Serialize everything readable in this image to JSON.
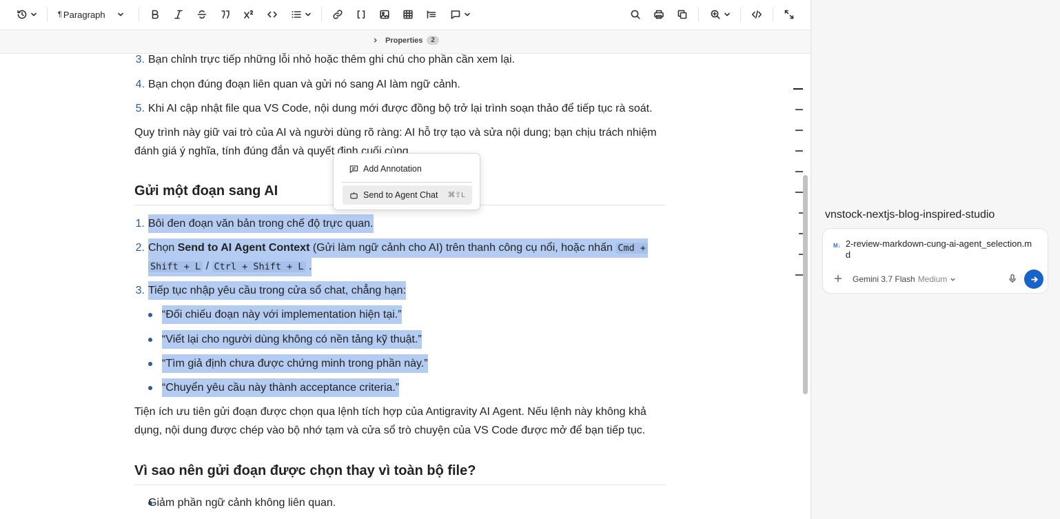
{
  "toolbar": {
    "paragraph_style": "Paragraph",
    "paragraph_mark": "¶"
  },
  "properties": {
    "label": "Properties",
    "count": "2"
  },
  "doc": {
    "item3": {
      "num": "3.",
      "text": "Bạn chỉnh trực tiếp những lỗi nhỏ hoặc thêm ghi chú cho phần cần xem lại."
    },
    "item4": {
      "num": "4.",
      "text": "Bạn chọn đúng đoạn liên quan và gửi nó sang AI làm ngữ cảnh."
    },
    "item5": {
      "num": "5.",
      "text": "Khi AI cập nhật file qua VS Code, nội dung mới được đồng bộ trở lại trình soạn thảo để tiếp tục rà soát."
    },
    "para1_line1": "Quy trình này giữ vai trò của AI và người dùng rõ ràng: AI hỗ trợ tạo và sửa nội dung; bạn chịu trách nhiệm",
    "para1_line2": "đánh giá ý nghĩa, tính đúng đắn và quyết định cuối cùng.",
    "heading1": "Gửi một đoạn sang AI",
    "step1": {
      "num": "1.",
      "text": "Bôi đen đoạn văn bản trong chế độ trực quan."
    },
    "step2": {
      "num": "2.",
      "pre": "Chọn ",
      "bold": "Send to AI Agent Context",
      "post": " (Gửi làm ngữ cảnh cho AI) trên thanh công cụ nổi, hoặc nhấn ",
      "code1a": "Cmd +",
      "code1b": "Shift + L",
      "slash": "/",
      "code2": "Ctrl + Shift + L",
      "end": "."
    },
    "step3": {
      "num": "3.",
      "text": "Tiếp tục nhập yêu cầu trong cửa sổ chat, chẳng hạn:"
    },
    "bullets": [
      "“Đối chiếu đoạn này với implementation hiện tại.”",
      "“Viết lại cho người dùng không có nền tảng kỹ thuật.”",
      "“Tìm giả định chưa được chứng minh trong phần này.”",
      "“Chuyển yêu cầu này thành acceptance criteria.”"
    ],
    "para2_line1": "Tiện ích ưu tiên gửi đoạn được chọn qua lệnh tích hợp của Antigravity AI Agent. Nếu lệnh này không khả",
    "para2_line2": "dụng, nội dung được chép vào bộ nhớ tạm và cửa sổ trò chuyện của VS Code được mở để bạn tiếp tục.",
    "heading2": "Vì sao nên gửi đoạn được chọn thay vì toàn bộ file?",
    "bullet_last": "Giảm phần ngữ cảnh không liên quan."
  },
  "context_menu": {
    "add_annotation": "Add Annotation",
    "send_to_chat": "Send to Agent Chat",
    "send_shortcut": "⌘⇧L"
  },
  "side": {
    "project": "vnstock-nextjs-blog-inspired-studio",
    "md_badge": "M↓",
    "file": "2-review-markdown-cung-ai-agent_selection.md",
    "model": "Gemini 3.7 Flash",
    "level": "Medium"
  },
  "colors": {
    "accent": "#1862c8",
    "selection": "#b4ccf1",
    "list_number": "#2b5aa7"
  }
}
